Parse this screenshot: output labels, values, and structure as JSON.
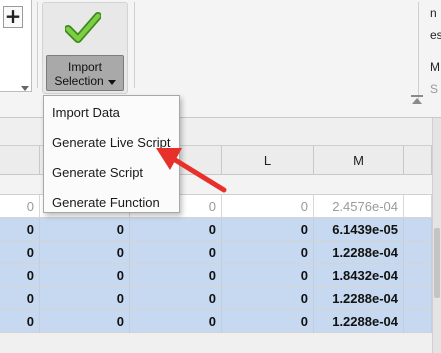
{
  "ribbon": {
    "plus_label": "+",
    "import_button": {
      "line1": "Import",
      "line2": "Selection"
    },
    "right_edge_text": [
      "n",
      "es",
      "M",
      "S"
    ]
  },
  "menu": {
    "items": [
      "Import Data",
      "Generate Live Script",
      "Generate Script",
      "Generate Function"
    ]
  },
  "columns": {
    "headers": [
      "",
      "",
      "",
      "",
      "L",
      "M"
    ]
  },
  "rows": [
    {
      "style": "white",
      "cells": [
        "0",
        "0",
        "0",
        "0",
        "0",
        "2.4576e-04"
      ]
    },
    {
      "style": "selected",
      "cells": [
        "0",
        "0",
        "0",
        "0",
        "0",
        "6.1439e-05"
      ]
    },
    {
      "style": "selected",
      "cells": [
        "0",
        "0",
        "0",
        "0",
        "0",
        "1.2288e-04"
      ]
    },
    {
      "style": "selected",
      "cells": [
        "0",
        "0",
        "0",
        "0",
        "0",
        "1.8432e-04"
      ]
    },
    {
      "style": "selected",
      "cells": [
        "0",
        "0",
        "0",
        "0",
        "0",
        "1.2288e-04"
      ]
    },
    {
      "style": "selected",
      "cells": [
        "0",
        "0",
        "0",
        "0",
        "0",
        "1.2288e-04"
      ]
    }
  ],
  "colors": {
    "selection": "#c6d9f0",
    "arrow": "#e8302a",
    "check": "#5cb130"
  }
}
